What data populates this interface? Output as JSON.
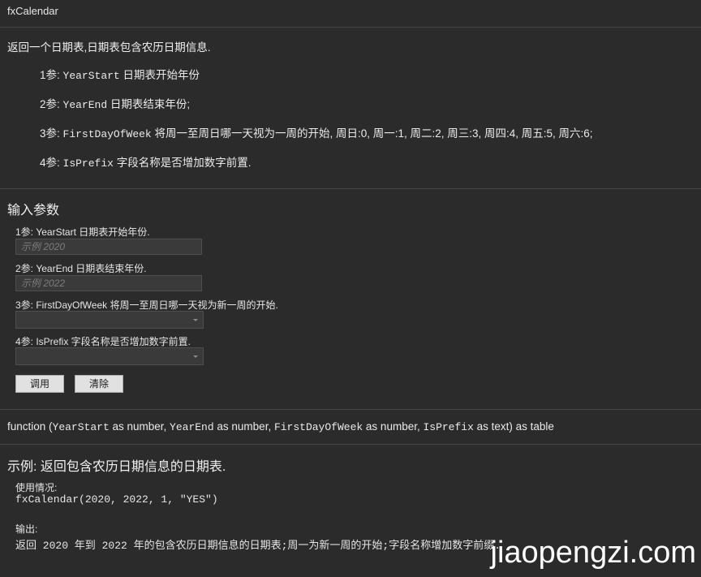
{
  "window": {
    "title": "fxCalendar"
  },
  "description": {
    "summary": "返回一个日期表,日期表包含农历日期信息.",
    "params": [
      {
        "prefix": "1参: ",
        "name": "YearStart",
        "text": " 日期表开始年份"
      },
      {
        "prefix": "2参: ",
        "name": "YearEnd",
        "text": " 日期表结束年份;"
      },
      {
        "prefix": "3参: ",
        "name": "FirstDayOfWeek",
        "text": " 将周一至周日哪一天视为一周的开始, 周日:0, 周一:1, 周二:2, 周三:3, 周四:4, 周五:5, 周六:6;"
      },
      {
        "prefix": "4参: ",
        "name": "IsPrefix",
        "text": " 字段名称是否增加数字前置."
      }
    ]
  },
  "inputs": {
    "heading": "输入参数",
    "fields": [
      {
        "label": "1参: YearStart 日期表开始年份.",
        "placeholder": "示例 2020"
      },
      {
        "label": "2参: YearEnd 日期表结束年份.",
        "placeholder": "示例 2022"
      },
      {
        "label": "3参: FirstDayOfWeek 将周一至周日哪一天视为新一周的开始.",
        "value": ""
      },
      {
        "label": "4参: IsPrefix 字段名称是否增加数字前置.",
        "value": ""
      }
    ],
    "invoke_label": "调用",
    "clear_label": "清除"
  },
  "signature": {
    "p1": "function (",
    "a1": "YearStart",
    "t1": " as number, ",
    "a2": "YearEnd",
    "t2": " as number, ",
    "a3": "FirstDayOfWeek",
    "t3": " as number, ",
    "a4": "IsPrefix",
    "t4": " as text) as table"
  },
  "example": {
    "title": "示例: 返回包含农历日期信息的日期表.",
    "usage_label": "使用情况:",
    "usage_code": "fxCalendar(2020, 2022, 1, \"YES\")",
    "output_label": "输出:",
    "output_text": "返回 2020 年到 2022 年的包含农历日期信息的日期表;周一为新一周的开始;字段名称增加数字前缀."
  },
  "watermark": "jiaopengzi.com"
}
